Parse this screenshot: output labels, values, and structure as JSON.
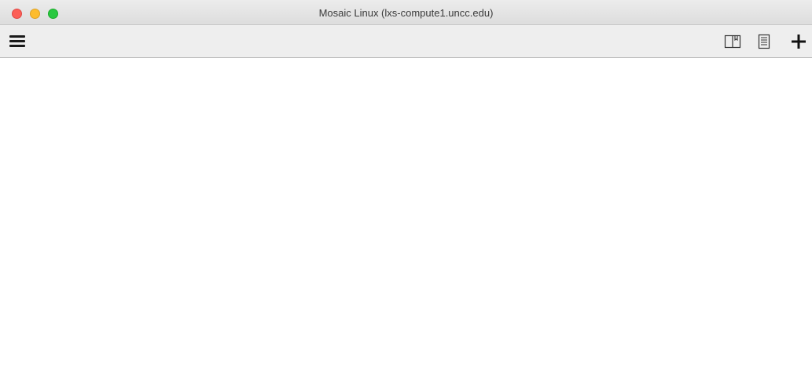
{
  "window": {
    "title": "Mosaic Linux (lxs-compute1.uncc.edu)"
  },
  "controls": {
    "close": "close-window",
    "minimize": "minimize-window",
    "zoom": "zoom-window"
  },
  "toolbar": {
    "menu_icon": "hamburger-menu-icon",
    "right_icons": [
      "book-icon",
      "notes-icon",
      "plus-icon"
    ]
  },
  "colors": {
    "close": "#fc5f57",
    "minimize": "#fdbc2e",
    "zoom": "#29c840",
    "toolbar_bg": "#eeeeee"
  }
}
